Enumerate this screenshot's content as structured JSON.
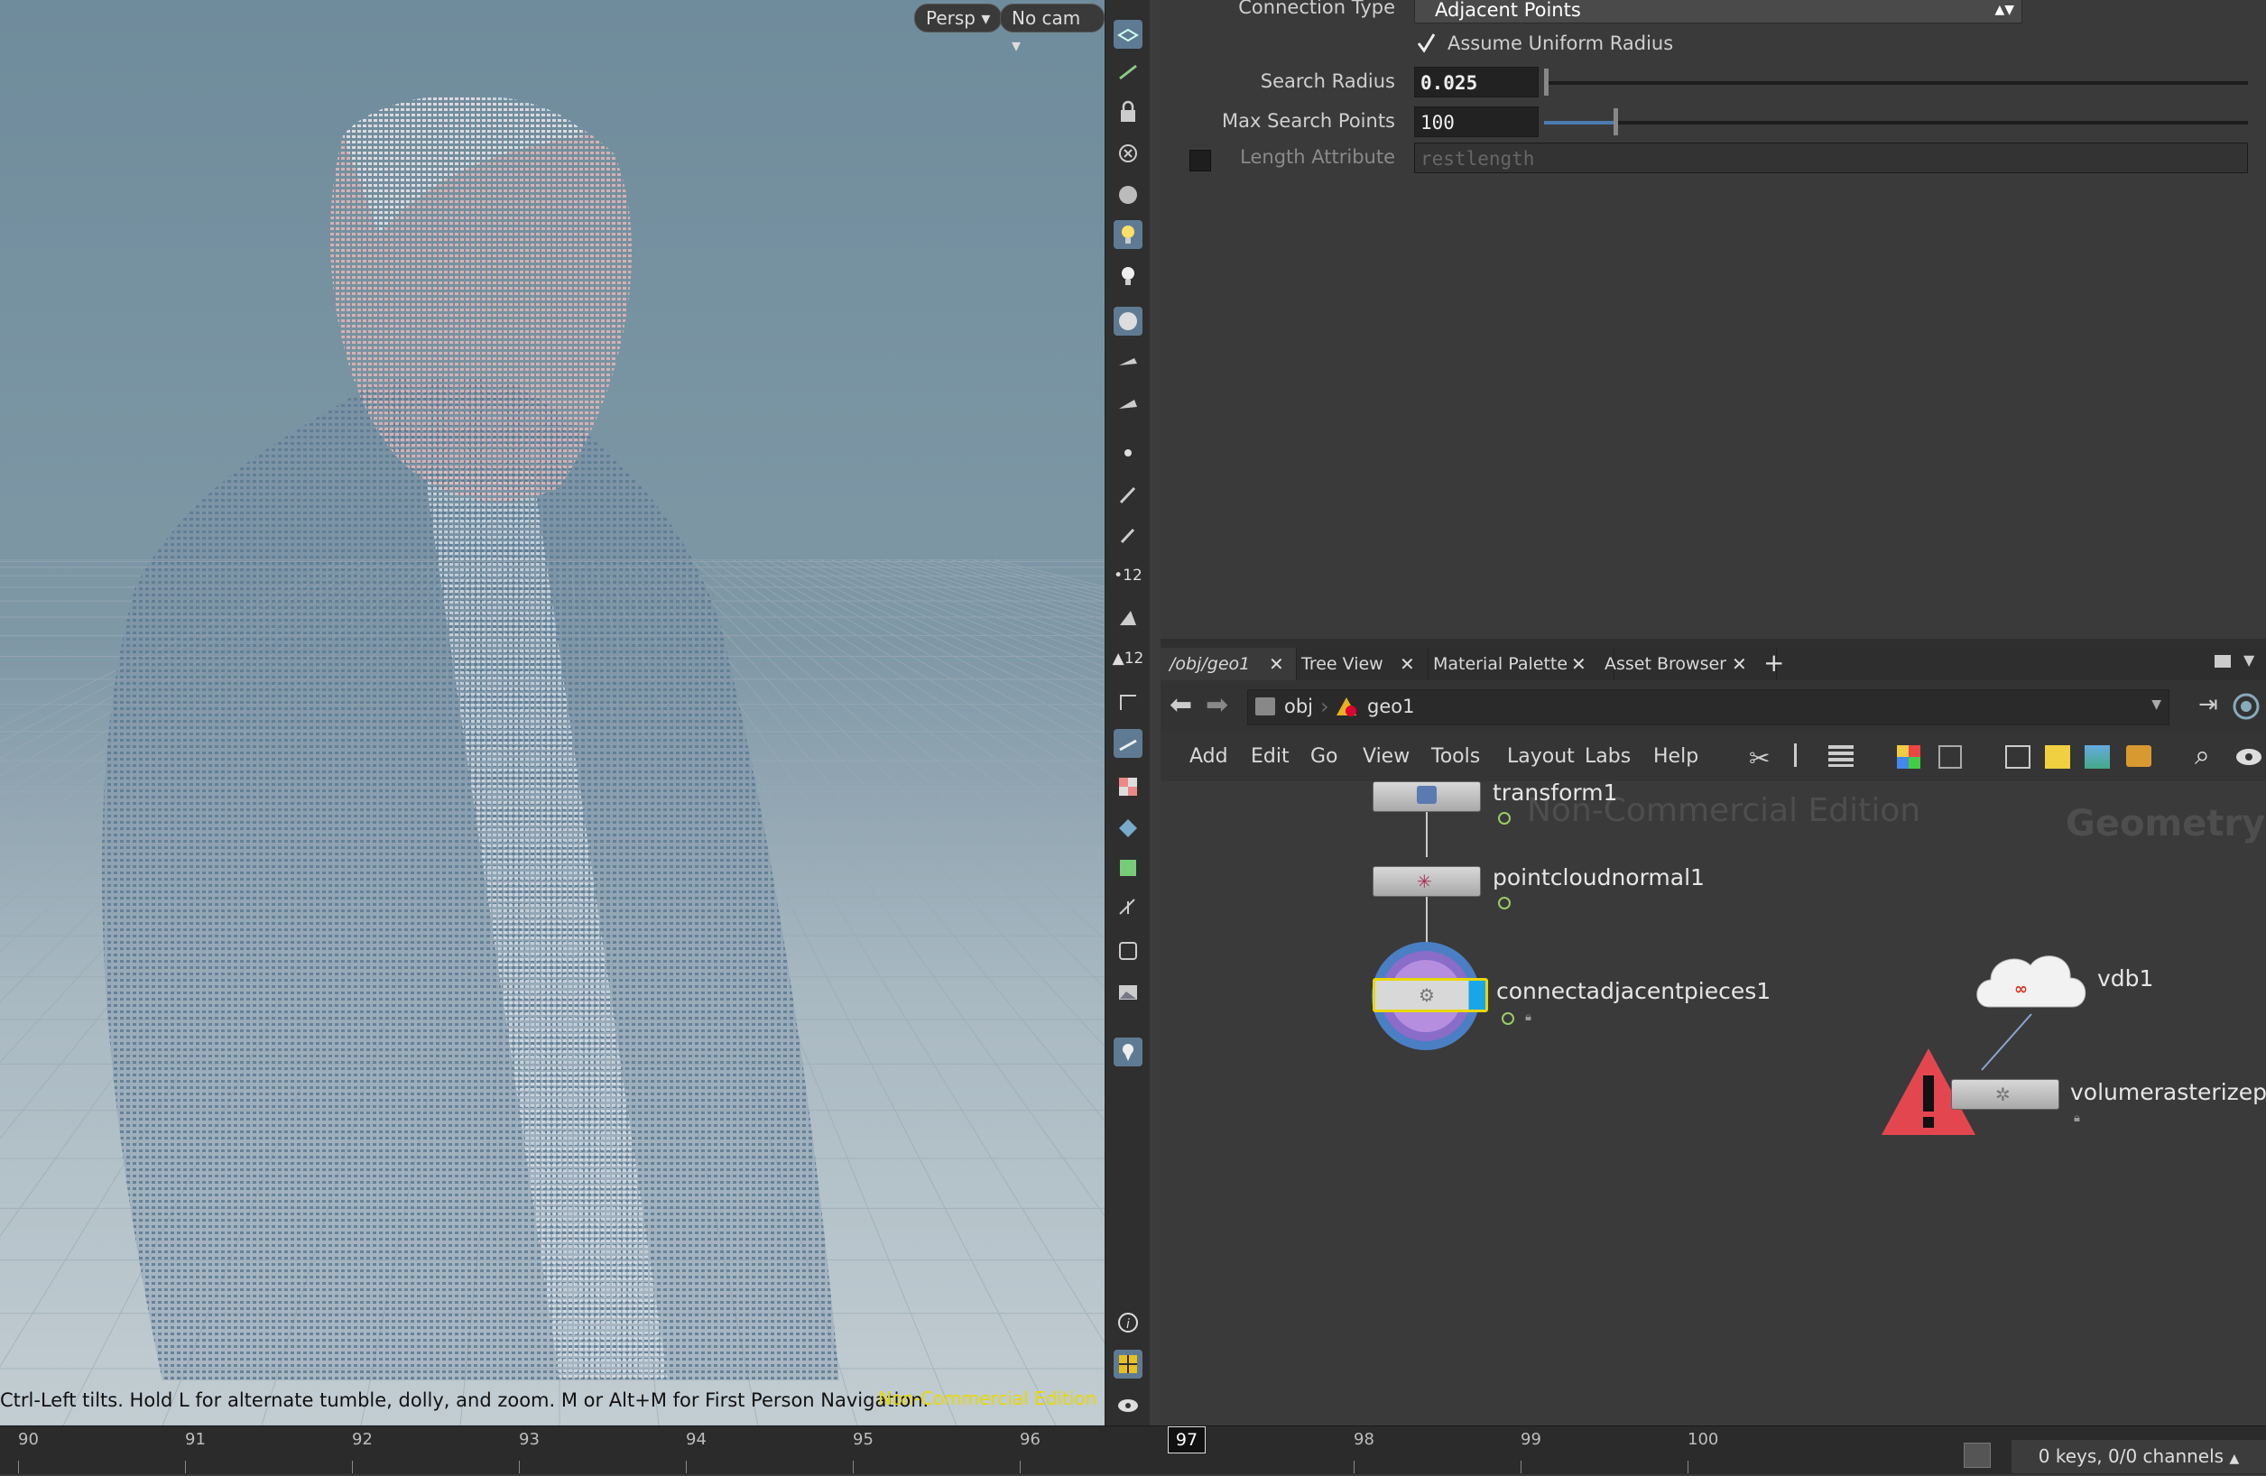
{
  "viewport": {
    "persp_label": "Persp",
    "camera_label": "No cam",
    "nav_hint": "Ctrl-Left tilts. Hold L for alternate tumble, dolly, and zoom. M or Alt+M for First Person Navigation.",
    "watermark": "Non-Commercial Edition"
  },
  "params": {
    "connection_type_label": "Connection Type",
    "connection_type_value": "Adjacent Points",
    "assume_uniform_radius_label": "Assume Uniform Radius",
    "assume_uniform_radius_checked": true,
    "search_radius_label": "Search Radius",
    "search_radius_value": "0.025",
    "max_search_points_label": "Max Search Points",
    "max_search_points_value": "100",
    "length_attribute_label": "Length Attribute",
    "length_attribute_placeholder": "restlength",
    "length_attribute_enabled": false
  },
  "tabs": [
    {
      "label": "/obj/geo1",
      "active": true
    },
    {
      "label": "Tree View",
      "active": false
    },
    {
      "label": "Material Palette",
      "active": false
    },
    {
      "label": "Asset Browser",
      "active": false
    }
  ],
  "path": {
    "obj_label": "obj",
    "geo_label": "geo1"
  },
  "menu": [
    "Add",
    "Edit",
    "Go",
    "View",
    "Tools",
    "Layout",
    "Labs",
    "Help"
  ],
  "network": {
    "watermark": "Non-Commercial Edition",
    "context_label": "Geometry",
    "nodes": {
      "transform": "transform1",
      "pointcloudnormal": "pointcloudnormal1",
      "connectadjacentpieces": "connectadjacentpieces1",
      "vdb": "vdb1",
      "volumerasterize": "volumerasterizepoi"
    }
  },
  "timeline": {
    "ticks": [
      "90",
      "91",
      "92",
      "93",
      "94",
      "95",
      "96",
      "97",
      "98",
      "99",
      "100"
    ],
    "current_frame": "97",
    "keys_info": "0 keys, 0/0 channels"
  },
  "colors": {
    "accent": "#e8d800",
    "selected_node_ring": "#6b5fa5",
    "error": "#e4464f"
  }
}
